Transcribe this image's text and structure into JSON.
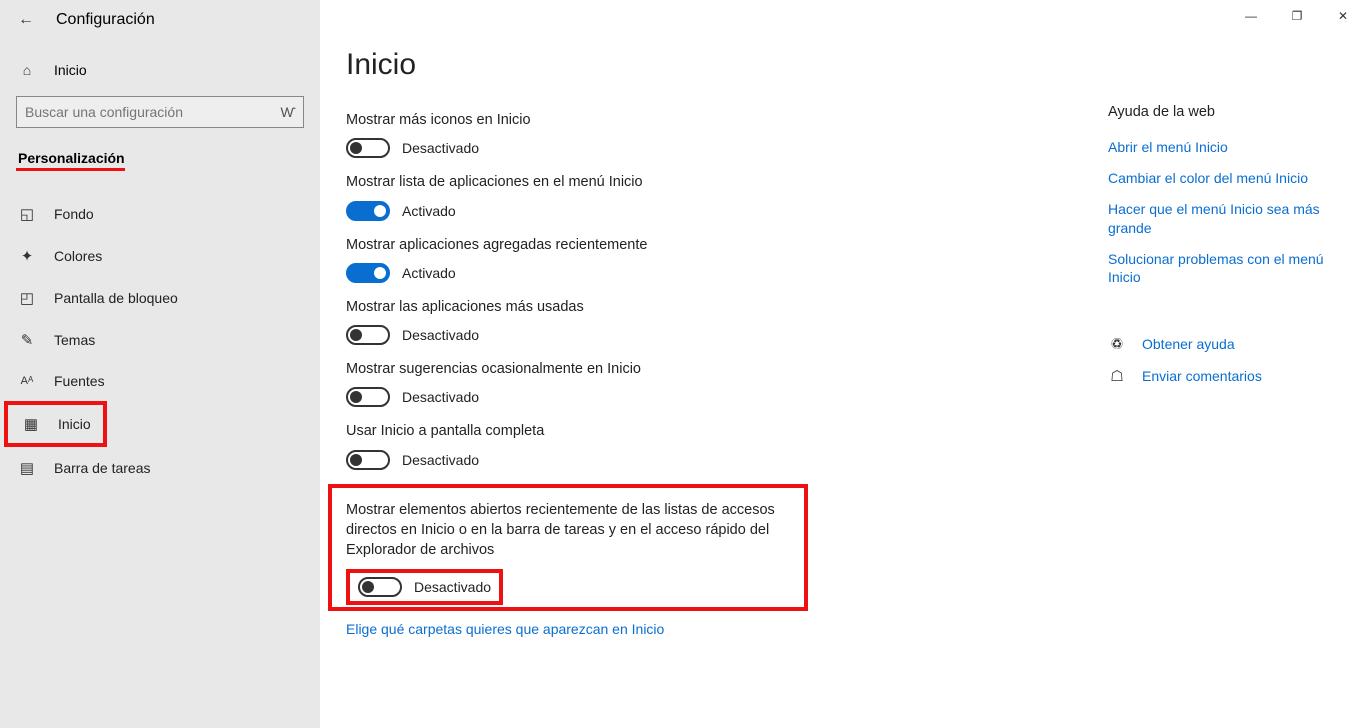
{
  "header": {
    "app_title": "Configuración"
  },
  "sidebar": {
    "home_label": "Inicio",
    "search_placeholder": "Buscar una configuración",
    "category": "Personalización",
    "items": [
      {
        "label": "Fondo",
        "icon": "image-icon"
      },
      {
        "label": "Colores",
        "icon": "palette-icon"
      },
      {
        "label": "Pantalla de bloqueo",
        "icon": "lock-screen-icon"
      },
      {
        "label": "Temas",
        "icon": "themes-icon"
      },
      {
        "label": "Fuentes",
        "icon": "fonts-icon"
      },
      {
        "label": "Inicio",
        "icon": "start-icon"
      },
      {
        "label": "Barra de tareas",
        "icon": "taskbar-icon"
      }
    ]
  },
  "page": {
    "title": "Inicio"
  },
  "settings": [
    {
      "label": "Mostrar más iconos en Inicio",
      "on": false,
      "state": "Desactivado"
    },
    {
      "label": "Mostrar lista de aplicaciones en el menú Inicio",
      "on": true,
      "state": "Activado"
    },
    {
      "label": "Mostrar aplicaciones agregadas recientemente",
      "on": true,
      "state": "Activado"
    },
    {
      "label": "Mostrar las aplicaciones más usadas",
      "on": false,
      "state": "Desactivado"
    },
    {
      "label": "Mostrar sugerencias ocasionalmente en Inicio",
      "on": false,
      "state": "Desactivado"
    },
    {
      "label": "Usar Inicio a pantalla completa",
      "on": false,
      "state": "Desactivado"
    },
    {
      "label": "Mostrar elementos abiertos recientemente de las listas de accesos directos en Inicio o en la barra de tareas y en el acceso rápido del Explorador de archivos",
      "on": false,
      "state": "Desactivado"
    }
  ],
  "folder_link": "Elige qué carpetas quieres que aparezcan en Inicio",
  "help": {
    "title": "Ayuda de la web",
    "links": [
      "Abrir el menú Inicio",
      "Cambiar el color del menú Inicio",
      "Hacer que el menú Inicio sea más grande",
      "Solucionar problemas con el menú Inicio"
    ],
    "get_help": "Obtener ayuda",
    "feedback": "Enviar comentarios"
  }
}
